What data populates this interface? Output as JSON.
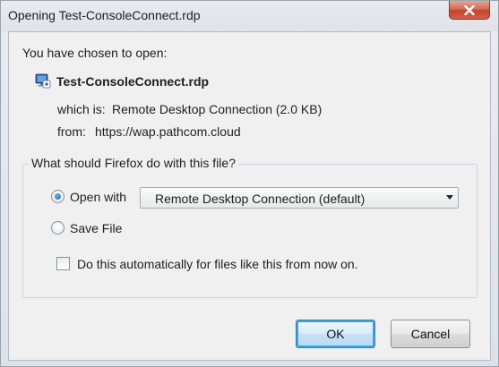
{
  "window": {
    "title": "Opening Test-ConsoleConnect.rdp"
  },
  "dialog": {
    "intro": "You have chosen to open:",
    "file_name": "Test-ConsoleConnect.rdp",
    "which_is_label": "which is:",
    "which_is_value": "Remote Desktop Connection (2.0 KB)",
    "from_label": "from:",
    "from_value": "https://wap.pathcom.cloud"
  },
  "action_group": {
    "legend": "What should Firefox do with this file?",
    "open_with_label": "Open with",
    "open_with_selected": true,
    "open_with_app": "Remote Desktop Connection (default)",
    "save_file_label": "Save File",
    "save_file_selected": false,
    "auto_label": "Do this automatically for files like this from now on.",
    "auto_checked": false
  },
  "buttons": {
    "ok": "OK",
    "cancel": "Cancel"
  },
  "icons": {
    "file": "remote-desktop-file-icon",
    "close": "close-icon",
    "dropdown": "chevron-down-icon"
  },
  "colors": {
    "close_button": "#c4432a",
    "default_button_border": "#39a6dd"
  }
}
